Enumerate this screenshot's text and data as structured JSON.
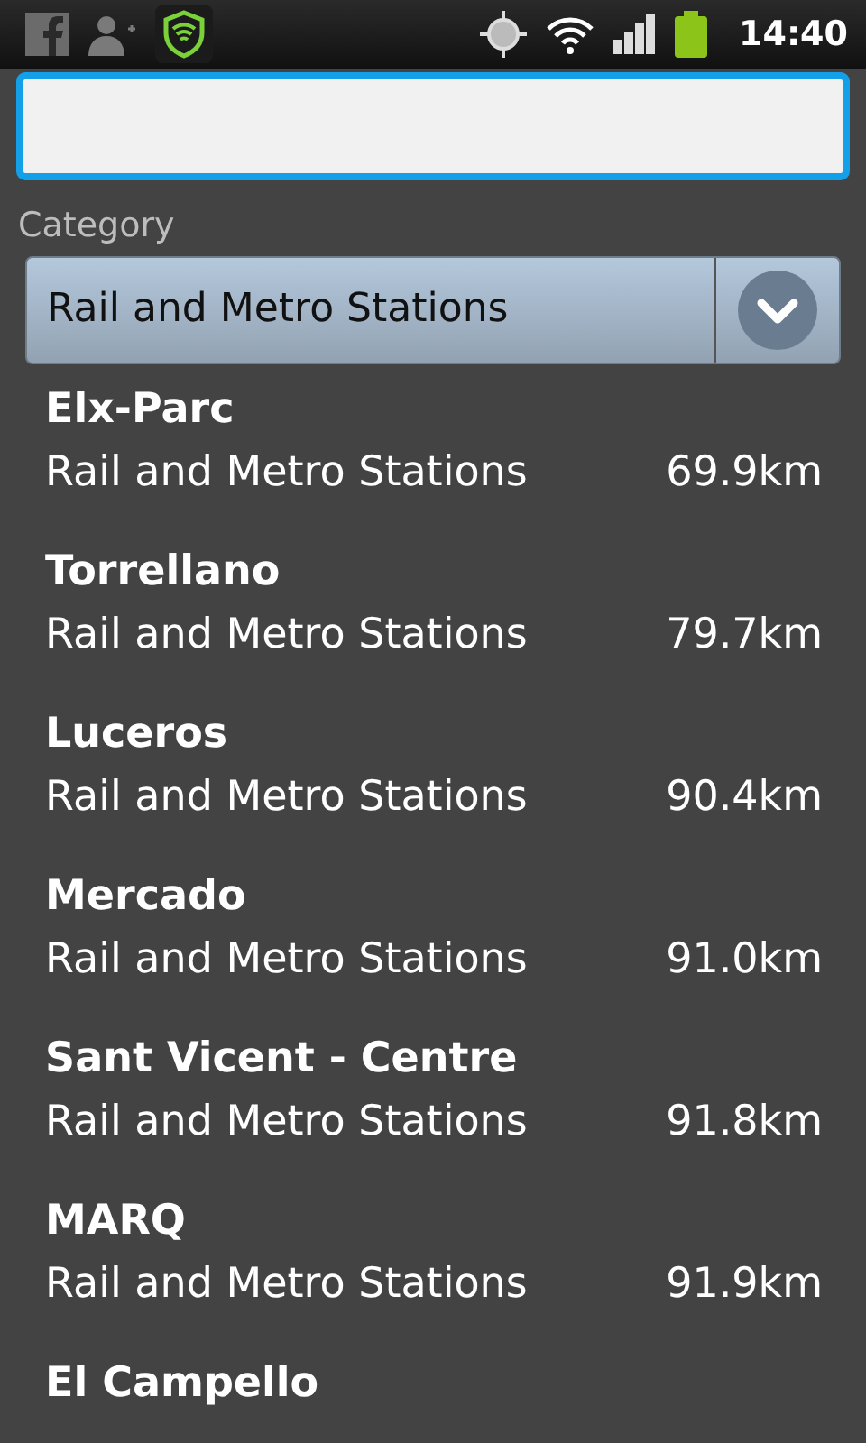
{
  "status_bar": {
    "time": "14:40"
  },
  "search": {
    "focused": true
  },
  "category": {
    "label": "Category",
    "value": "Rail and Metro Stations"
  },
  "results": [
    {
      "name": "Elx-Parc",
      "category": "Rail and Metro Stations",
      "distance": "69.9km"
    },
    {
      "name": "Torrellano",
      "category": "Rail and Metro Stations",
      "distance": "79.7km"
    },
    {
      "name": "Luceros",
      "category": "Rail and Metro Stations",
      "distance": "90.4km"
    },
    {
      "name": "Mercado",
      "category": "Rail and Metro Stations",
      "distance": "91.0km"
    },
    {
      "name": "Sant Vicent - Centre",
      "category": "Rail and Metro Stations",
      "distance": "91.8km"
    },
    {
      "name": "MARQ",
      "category": "Rail and Metro Stations",
      "distance": "91.9km"
    },
    {
      "name": "El Campello"
    }
  ]
}
